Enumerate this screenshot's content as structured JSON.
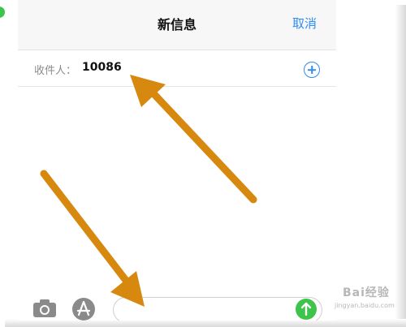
{
  "header": {
    "title": "新信息",
    "cancel_label": "取消"
  },
  "recipient": {
    "label": "收件人：",
    "value": "10086",
    "add_icon": "plus-circle-icon"
  },
  "toolbar": {
    "camera_icon": "camera-icon",
    "apps_icon": "app-store-icon",
    "message_value": "",
    "send_icon": "arrow-up-icon"
  },
  "annotations": {
    "arrow_color": "#d7890f"
  },
  "watermark": {
    "text": "Bai经验",
    "sub": "jingyan.baidu.com"
  },
  "colors": {
    "accent": "#2f8cf0",
    "send": "#3dc44a"
  }
}
